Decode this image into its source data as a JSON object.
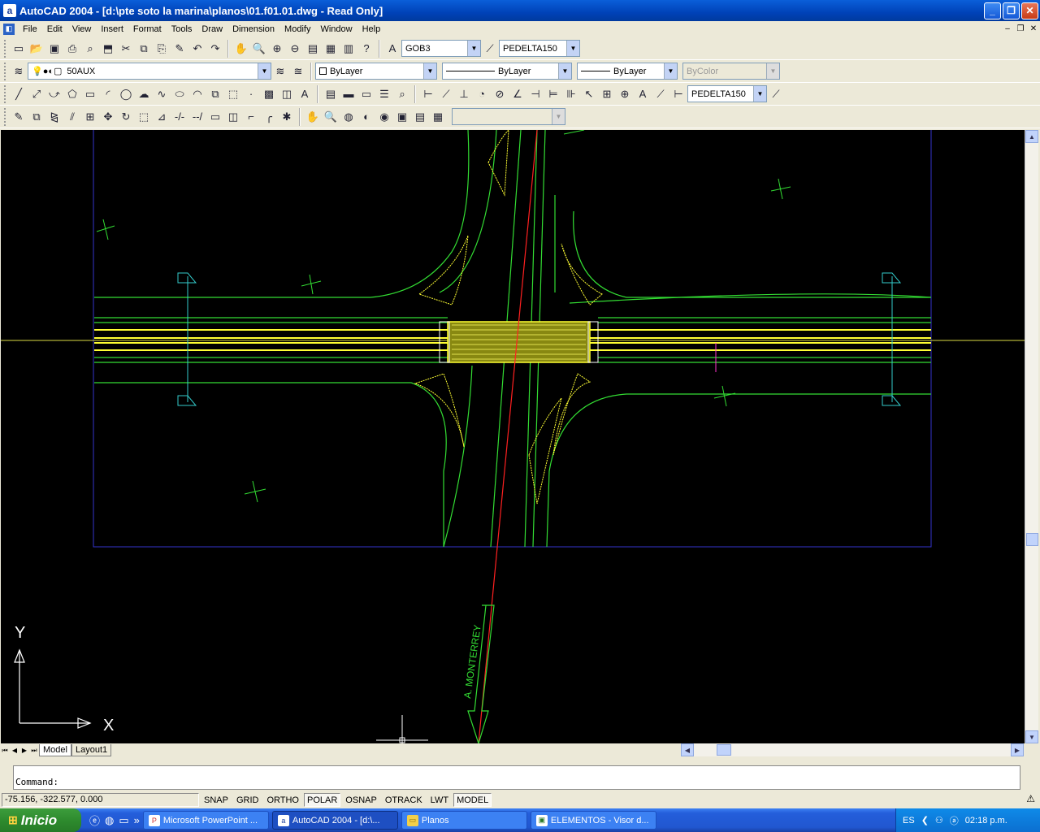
{
  "window": {
    "title": "AutoCAD 2004 - [d:\\pte soto la marina\\planos\\01.f01.01.dwg - Read Only]",
    "app_icon": "a",
    "minimize": "_",
    "maximize": "❐",
    "close": "✕"
  },
  "menu": [
    "File",
    "Edit",
    "View",
    "Insert",
    "Format",
    "Tools",
    "Draw",
    "Dimension",
    "Modify",
    "Window",
    "Help"
  ],
  "toolbar_std": {
    "text_style": "GOB3",
    "dim_style": "PEDELTA150"
  },
  "toolbar_layers": {
    "layer": "50AUX",
    "color": "ByLayer",
    "linetype": "ByLayer",
    "lineweight": "ByLayer",
    "plotstyle": "ByColor"
  },
  "toolbar_dim": {
    "dim_style": "PEDELTA150"
  },
  "drawing": {
    "annotation": "A. MONTERREY",
    "ucs_x": "X",
    "ucs_y": "Y"
  },
  "tabs": {
    "model": "Model",
    "layout1": "Layout1"
  },
  "command": {
    "prompt": "Command:"
  },
  "status": {
    "coords": "-75.156,  -322.577, 0.000",
    "buttons": [
      {
        "label": "SNAP",
        "on": false
      },
      {
        "label": "GRID",
        "on": false
      },
      {
        "label": "ORTHO",
        "on": false
      },
      {
        "label": "POLAR",
        "on": true
      },
      {
        "label": "OSNAP",
        "on": false
      },
      {
        "label": "OTRACK",
        "on": false
      },
      {
        "label": "LWT",
        "on": false
      },
      {
        "label": "MODEL",
        "on": true
      }
    ]
  },
  "taskbar": {
    "start": "Inicio",
    "tasks": [
      {
        "label": "Microsoft PowerPoint ...",
        "icon": "P",
        "active": false
      },
      {
        "label": "AutoCAD 2004 - [d:\\...",
        "icon": "a",
        "active": true
      },
      {
        "label": "Planos",
        "icon": "▭",
        "active": false
      },
      {
        "label": "ELEMENTOS - Visor d...",
        "icon": "▣",
        "active": false
      }
    ],
    "lang": "ES",
    "clock": "02:18 p.m."
  },
  "colors": {
    "titlebar": "#0a5fd9",
    "drawing_bg": "#000000",
    "road": "#22cc22",
    "hatch": "#ffff33",
    "centerline": "#ff2020",
    "section": "#33cccc",
    "frame": "#3333cc"
  }
}
